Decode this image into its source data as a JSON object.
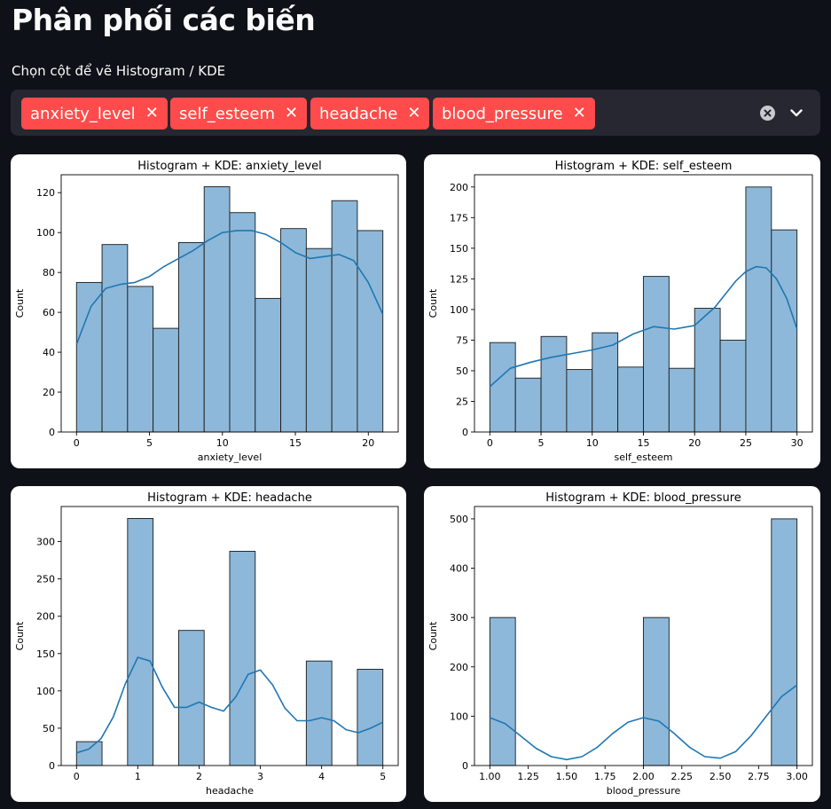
{
  "page": {
    "title": "Phân phối các biến",
    "select_label": "Chọn cột để vẽ Histogram / KDE"
  },
  "multiselect": {
    "chips": [
      "anxiety_level",
      "self_esteem",
      "headache",
      "blood_pressure"
    ],
    "clear_icon": "clear-circle-icon",
    "dropdown_icon": "chevron-down-icon"
  },
  "colors": {
    "background": "#0e1117",
    "chip": "#ff4b4b",
    "bar_fill": "#8db8d9",
    "kde_line": "#1f77b4"
  },
  "chart_data": [
    {
      "type": "bar",
      "title": "Histogram + KDE: anxiety_level",
      "xlabel": "anxiety_level",
      "ylabel": "Count",
      "xlim": [
        -1.05,
        22.05
      ],
      "ylim": [
        0,
        129
      ],
      "xticks": [
        0,
        5,
        10,
        15,
        20
      ],
      "yticks": [
        0,
        20,
        40,
        60,
        80,
        100,
        120
      ],
      "bins": [
        [
          0,
          1.75
        ],
        [
          1.75,
          3.5
        ],
        [
          3.5,
          5.25
        ],
        [
          5.25,
          7
        ],
        [
          7,
          8.75
        ],
        [
          8.75,
          10.5
        ],
        [
          10.5,
          12.25
        ],
        [
          12.25,
          14
        ],
        [
          14,
          15.75
        ],
        [
          15.75,
          17.5
        ],
        [
          17.5,
          19.25
        ],
        [
          19.25,
          21
        ]
      ],
      "values": [
        75,
        94,
        73,
        52,
        95,
        123,
        110,
        67,
        102,
        92,
        116,
        101
      ],
      "kde": {
        "x": [
          0,
          1,
          2,
          3,
          4,
          5,
          6,
          7,
          8,
          9,
          10,
          11,
          12,
          13,
          14,
          15,
          16,
          17,
          18,
          19,
          20,
          21
        ],
        "y": [
          44,
          63,
          72,
          74,
          75,
          78,
          83,
          87,
          91,
          96,
          100,
          101,
          101,
          99,
          95,
          90,
          87,
          88,
          89,
          86,
          75,
          59
        ]
      }
    },
    {
      "type": "bar",
      "title": "Histogram + KDE: self_esteem",
      "xlabel": "self_esteem",
      "ylabel": "Count",
      "xlim": [
        -1.5,
        31.5
      ],
      "ylim": [
        0,
        210
      ],
      "xticks": [
        0,
        5,
        10,
        15,
        20,
        25,
        30
      ],
      "yticks": [
        0,
        25,
        50,
        75,
        100,
        125,
        150,
        175,
        200
      ],
      "bins": [
        [
          0,
          2.5
        ],
        [
          2.5,
          5
        ],
        [
          5,
          7.5
        ],
        [
          7.5,
          10
        ],
        [
          10,
          12.5
        ],
        [
          12.5,
          15
        ],
        [
          15,
          17.5
        ],
        [
          17.5,
          20
        ],
        [
          20,
          22.5
        ],
        [
          22.5,
          25
        ],
        [
          25,
          27.5
        ],
        [
          27.5,
          30
        ]
      ],
      "values": [
        73,
        44,
        78,
        51,
        81,
        53,
        127,
        52,
        101,
        75,
        200,
        165
      ],
      "kde": {
        "x": [
          0,
          2,
          4,
          6,
          8,
          10,
          12,
          14,
          16,
          18,
          20,
          22,
          24,
          25,
          26,
          27,
          28,
          29,
          30
        ],
        "y": [
          37,
          52,
          57,
          61,
          64,
          67,
          71,
          80,
          86,
          84,
          87,
          102,
          123,
          131,
          135,
          134,
          125,
          109,
          84
        ]
      }
    },
    {
      "type": "bar",
      "title": "Histogram + KDE: headache",
      "xlabel": "headache",
      "ylabel": "Count",
      "xlim": [
        -0.25,
        5.25
      ],
      "ylim": [
        0,
        347
      ],
      "xticks": [
        0,
        1,
        2,
        3,
        4,
        5
      ],
      "yticks": [
        0,
        50,
        100,
        150,
        200,
        250,
        300
      ],
      "bins": [
        [
          0,
          0.4167
        ],
        [
          0.8333,
          1.25
        ],
        [
          1.6667,
          2.0833
        ],
        [
          2.5,
          2.9167
        ],
        [
          3.75,
          4.1667
        ],
        [
          4.5833,
          5
        ]
      ],
      "values": [
        32,
        331,
        181,
        287,
        140,
        129
      ],
      "kde": {
        "x": [
          0,
          0.2,
          0.4,
          0.6,
          0.8,
          1.0,
          1.2,
          1.4,
          1.6,
          1.8,
          2.0,
          2.2,
          2.4,
          2.6,
          2.8,
          3.0,
          3.2,
          3.4,
          3.6,
          3.8,
          4.0,
          4.2,
          4.4,
          4.6,
          4.8,
          5.0
        ],
        "y": [
          17,
          22,
          36,
          65,
          110,
          145,
          140,
          105,
          78,
          78,
          85,
          78,
          73,
          92,
          122,
          128,
          108,
          77,
          60,
          60,
          64,
          60,
          48,
          44,
          50,
          58
        ]
      }
    },
    {
      "type": "bar",
      "title": "Histogram + KDE: blood_pressure",
      "xlabel": "blood_pressure",
      "ylabel": "Count",
      "xlim": [
        0.9,
        3.1
      ],
      "ylim": [
        0,
        525
      ],
      "xticks": [
        1.0,
        1.25,
        1.5,
        1.75,
        2.0,
        2.25,
        2.5,
        2.75,
        3.0
      ],
      "xtick_labels": [
        "1.00",
        "1.25",
        "1.50",
        "1.75",
        "2.00",
        "2.25",
        "2.50",
        "2.75",
        "3.00"
      ],
      "yticks": [
        0,
        100,
        200,
        300,
        400,
        500
      ],
      "bins": [
        [
          1.0,
          1.1667
        ],
        [
          2.0,
          2.1667
        ],
        [
          2.8333,
          3.0
        ]
      ],
      "values": [
        300,
        300,
        500
      ],
      "kde": {
        "x": [
          1.0,
          1.1,
          1.2,
          1.3,
          1.4,
          1.5,
          1.6,
          1.7,
          1.8,
          1.9,
          2.0,
          2.1,
          2.2,
          2.3,
          2.4,
          2.5,
          2.6,
          2.7,
          2.8,
          2.9,
          3.0
        ],
        "y": [
          97,
          85,
          60,
          35,
          18,
          12,
          18,
          37,
          65,
          88,
          97,
          90,
          65,
          37,
          18,
          15,
          28,
          60,
          100,
          140,
          163
        ]
      }
    }
  ]
}
